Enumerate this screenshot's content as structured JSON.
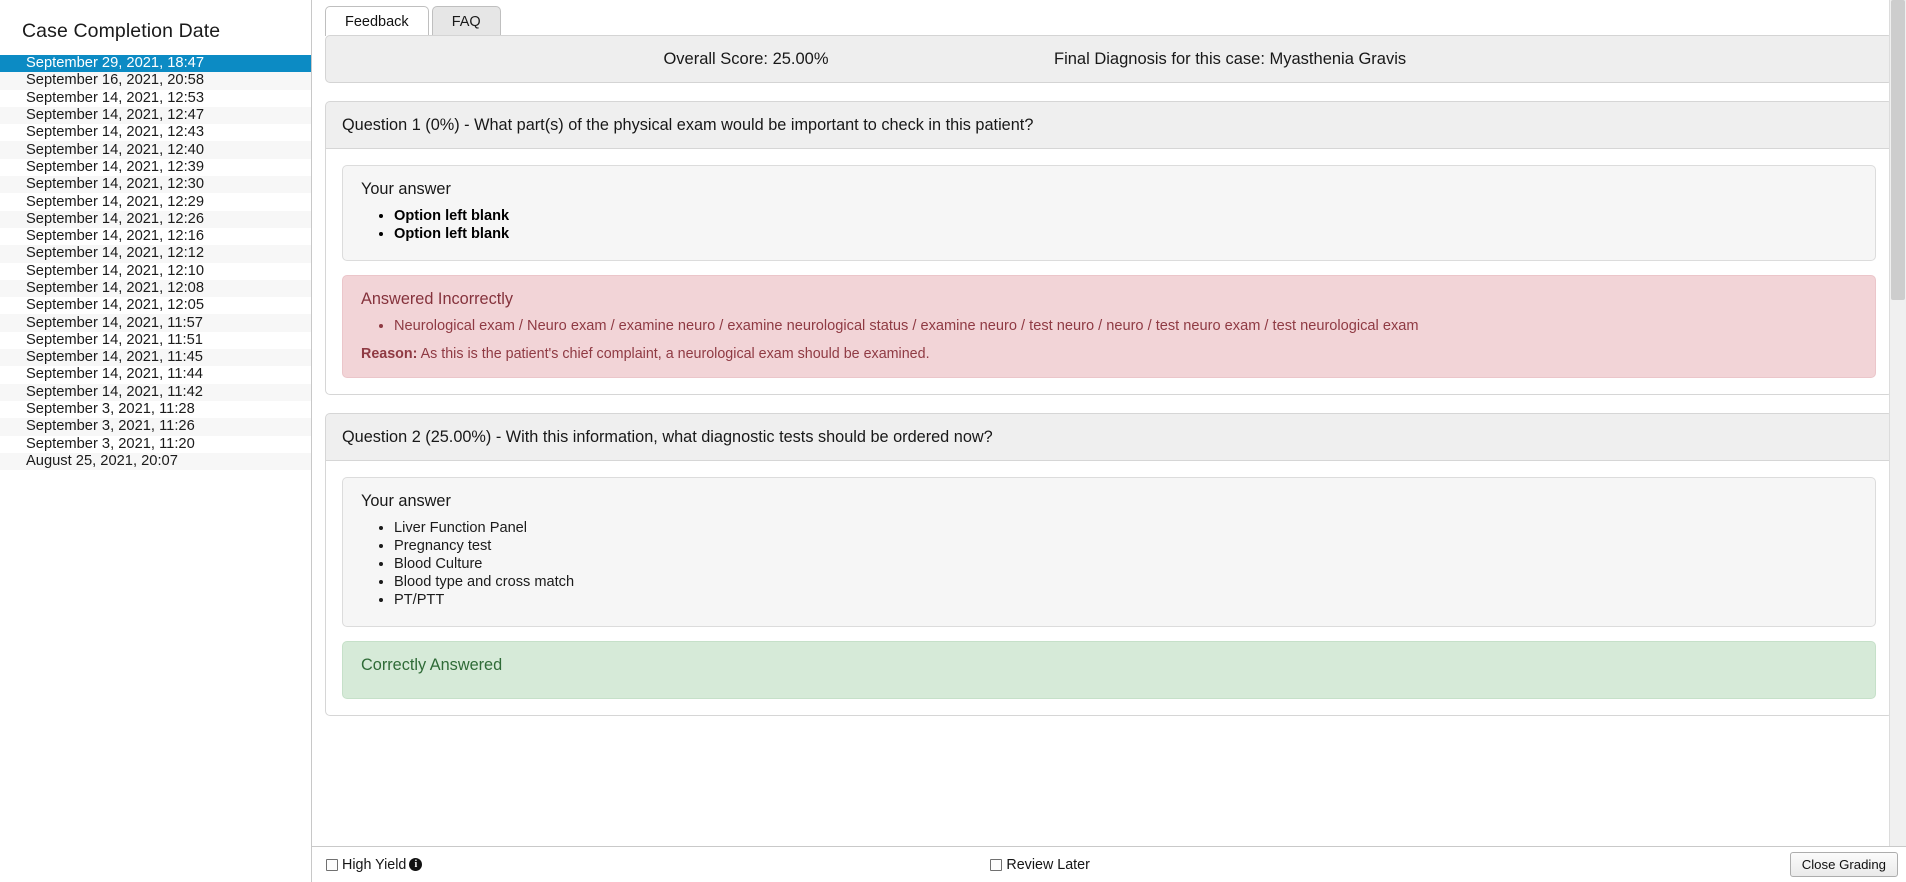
{
  "sidebar": {
    "title": "Case Completion Date",
    "items": [
      {
        "label": "September 29, 2021, 18:47",
        "selected": true
      },
      {
        "label": "September 16, 2021, 20:58",
        "selected": false
      },
      {
        "label": "September 14, 2021, 12:53",
        "selected": false
      },
      {
        "label": "September 14, 2021, 12:47",
        "selected": false
      },
      {
        "label": "September 14, 2021, 12:43",
        "selected": false
      },
      {
        "label": "September 14, 2021, 12:40",
        "selected": false
      },
      {
        "label": "September 14, 2021, 12:39",
        "selected": false
      },
      {
        "label": "September 14, 2021, 12:30",
        "selected": false
      },
      {
        "label": "September 14, 2021, 12:29",
        "selected": false
      },
      {
        "label": "September 14, 2021, 12:26",
        "selected": false
      },
      {
        "label": "September 14, 2021, 12:16",
        "selected": false
      },
      {
        "label": "September 14, 2021, 12:12",
        "selected": false
      },
      {
        "label": "September 14, 2021, 12:10",
        "selected": false
      },
      {
        "label": "September 14, 2021, 12:08",
        "selected": false
      },
      {
        "label": "September 14, 2021, 12:05",
        "selected": false
      },
      {
        "label": "September 14, 2021, 11:57",
        "selected": false
      },
      {
        "label": "September 14, 2021, 11:51",
        "selected": false
      },
      {
        "label": "September 14, 2021, 11:45",
        "selected": false
      },
      {
        "label": "September 14, 2021, 11:44",
        "selected": false
      },
      {
        "label": "September 14, 2021, 11:42",
        "selected": false
      },
      {
        "label": "September 3, 2021, 11:28",
        "selected": false
      },
      {
        "label": "September 3, 2021, 11:26",
        "selected": false
      },
      {
        "label": "September 3, 2021, 11:20",
        "selected": false
      },
      {
        "label": "August 25, 2021, 20:07",
        "selected": false
      }
    ]
  },
  "tabs": [
    {
      "label": "Feedback",
      "active": true
    },
    {
      "label": "FAQ",
      "active": false
    }
  ],
  "summary": {
    "overall_score": "Overall Score: 25.00%",
    "final_diagnosis": "Final Diagnosis for this case: Myasthenia Gravis"
  },
  "questions": [
    {
      "header": "Question 1 (0%) - What part(s) of the physical exam would be important to check in this patient?",
      "answer_title": "Your answer",
      "answers": [
        "Option left blank",
        "Option left blank"
      ],
      "answers_blank": true,
      "result_title": "Answered Incorrectly",
      "result_type": "incorrect",
      "result_items": [
        "Neurological exam / Neuro exam / examine neuro / examine neurological status / examine neuro / test neuro / neuro / test neuro exam / test neurological exam"
      ],
      "reason_label": "Reason:",
      "reason_text": "As this is the patient's chief complaint, a neurological exam should be examined."
    },
    {
      "header": "Question 2 (25.00%) - With this information, what diagnostic tests should be ordered now?",
      "answer_title": "Your answer",
      "answers": [
        "Liver Function Panel",
        "Pregnancy test",
        "Blood Culture",
        "Blood type and cross match",
        "PT/PTT"
      ],
      "answers_blank": false,
      "result_title": "Correctly Answered",
      "result_type": "correct",
      "result_items": [],
      "reason_label": "",
      "reason_text": ""
    }
  ],
  "footer": {
    "high_yield_label": "High Yield",
    "high_yield_checked": false,
    "info_icon_char": "i",
    "review_later_label": "Review Later",
    "review_later_checked": false,
    "close_grading_label": "Close Grading"
  },
  "colors": {
    "selection_blue": "#0c8bc4",
    "incorrect_bg": "#f2d4d7",
    "incorrect_text": "#8f3a43",
    "correct_bg": "#d6ead8",
    "correct_text": "#356d3c",
    "panel_gray": "#eeeeee"
  }
}
